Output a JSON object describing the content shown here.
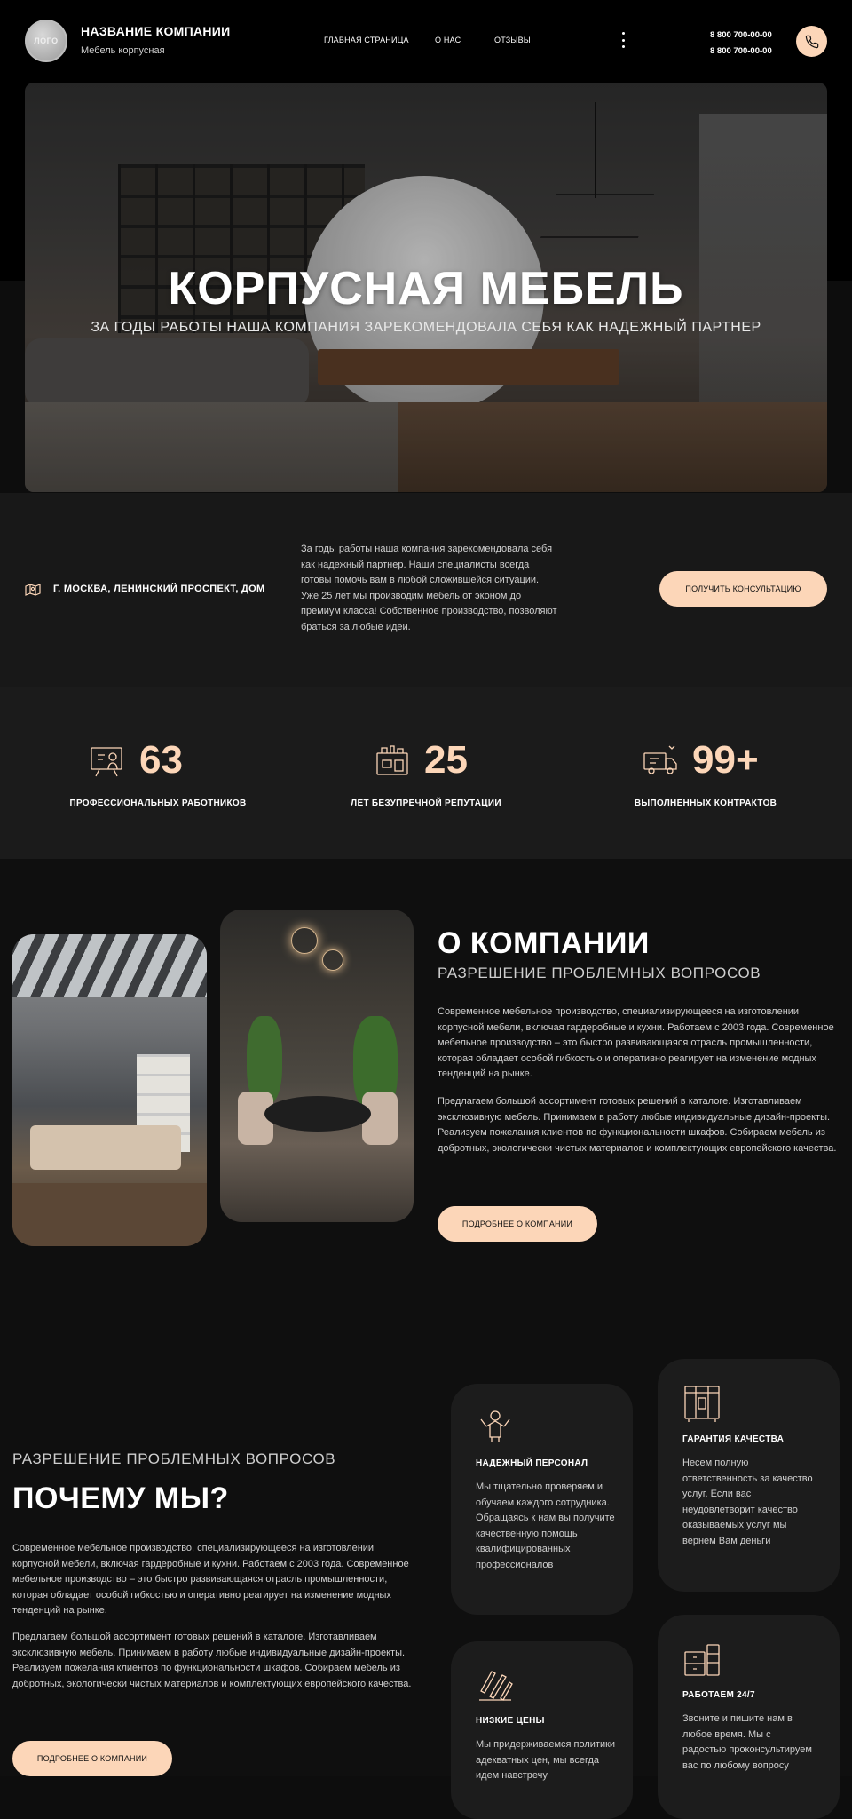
{
  "header": {
    "logo_text": "ЛОГО",
    "company_name": "НАЗВАНИЕ КОМПАНИИ",
    "company_tagline": "Мебель корпусная",
    "nav": [
      "ГЛАВНАЯ СТРАНИЦА",
      "О НАС",
      "ОТЗЫВЫ"
    ],
    "phones": [
      "8 800 700-00-00",
      "8 800 700-00-00"
    ]
  },
  "hero": {
    "title": "КОРПУСНАЯ МЕБЕЛЬ",
    "subtitle": "ЗА ГОДЫ РАБОТЫ НАША КОМПАНИЯ ЗАРЕКОМЕНДОВАЛА СЕБЯ КАК НАДЕЖНЫЙ ПАРТНЕР"
  },
  "info": {
    "address": "Г. МОСКВА, ЛЕНИНСКИЙ ПРОСПЕКТ, ДОМ",
    "text": "За годы работы наша компания зарекомендовала себя как надежный партнер. Наши специалисты всегда готовы помочь вам в любой сложившейся ситуации. Уже 25 лет мы производим мебель от эконом до премиум класса! Собственное производство, позволяют браться за любые идеи.",
    "cta": "ПОЛУЧИТЬ КОНСУЛЬТАЦИЮ"
  },
  "stats": [
    {
      "value": "63",
      "label": "ПРОФЕССИОНАЛЬНЫХ РАБОТНИКОВ",
      "icon": "designer-icon"
    },
    {
      "value": "25",
      "label": "ЛЕТ БЕЗУПРЕЧНОЙ РЕПУТАЦИИ",
      "icon": "workshop-icon"
    },
    {
      "value": "99+",
      "label": "ВЫПОЛНЕННЫХ КОНТРАКТОВ",
      "icon": "truck-icon"
    }
  ],
  "about": {
    "title": "О КОМПАНИИ",
    "kicker": "РАЗРЕШЕНИЕ ПРОБЛЕМНЫХ ВОПРОСОВ",
    "p1": "Современное мебельное производство, специализирующееся на изготовлении корпусной мебели, включая гардеробные и кухни. Работаем с 2003 года. Современное мебельное производство – это быстро развивающаяся отрасль промышленности, которая обладает особой гибкостью и оперативно реагирует на изменение модных тенденций на рынке.",
    "p2": "Предлагаем большой ассортимент готовых решений в каталоге. Изготавливаем эксклюзивную мебель. Принимаем в работу любые индивидуальные дизайн-проекты. Реализуем пожелания клиентов по функциональности шкафов. Собираем мебель из добротных, экологически чистых материалов и комплектующих европейского качества.",
    "cta": "ПОДРОБНЕЕ О КОМПАНИИ"
  },
  "why": {
    "kicker": "РАЗРЕШЕНИЕ ПРОБЛЕМНЫХ ВОПРОСОВ",
    "title": "ПОЧЕМУ МЫ?",
    "p1": "Современное мебельное производство, специализирующееся на изготовлении корпусной мебели, включая гардеробные и кухни. Работаем с 2003 года. Современное мебельное производство – это быстро развивающаяся отрасль промышленности, которая обладает особой гибкостью и оперативно реагирует на изменение модных тенденций на рынке.",
    "p2": "Предлагаем большой ассортимент готовых решений в каталоге. Изготавливаем эксклюзивную мебель. Принимаем в работу любые индивидуальные дизайн-проекты. Реализуем пожелания клиентов по функциональности шкафов. Собираем мебель из добротных, экологически чистых материалов и комплектующих европейского качества.",
    "cta": "ПОДРОБНЕЕ О КОМПАНИИ",
    "cards": [
      {
        "title": "НАДЕЖНЫЙ ПЕРСОНАЛ",
        "text": "Мы тщательно проверяем и обучаем каждого сотрудника. Обращаясь к нам вы получите качественную помощь квалифицированных профессионалов",
        "icon": "worker-icon"
      },
      {
        "title": "ГАРАНТИЯ КАЧЕСТВА",
        "text": "Несем полную ответственность за качество услуг. Если вас неудовлетворит качество оказываемых услуг мы вернем Вам деньги",
        "icon": "wardrobe-icon"
      },
      {
        "title": "НИЗКИЕ ЦЕНЫ",
        "text": "Мы придерживаемся политики адекватных цен, мы всегда идем навстречу",
        "icon": "tools-icon"
      },
      {
        "title": "РАБОТАЕМ 24/7",
        "text": "Звоните и пишите нам в любое время. Мы с радостью проконсультируем вас по любому вопросу",
        "icon": "cabinet-icon"
      }
    ]
  },
  "colors": {
    "accent": "#fcd6b8",
    "bg": "#0d0d0d",
    "card": "#1c1c1c"
  }
}
